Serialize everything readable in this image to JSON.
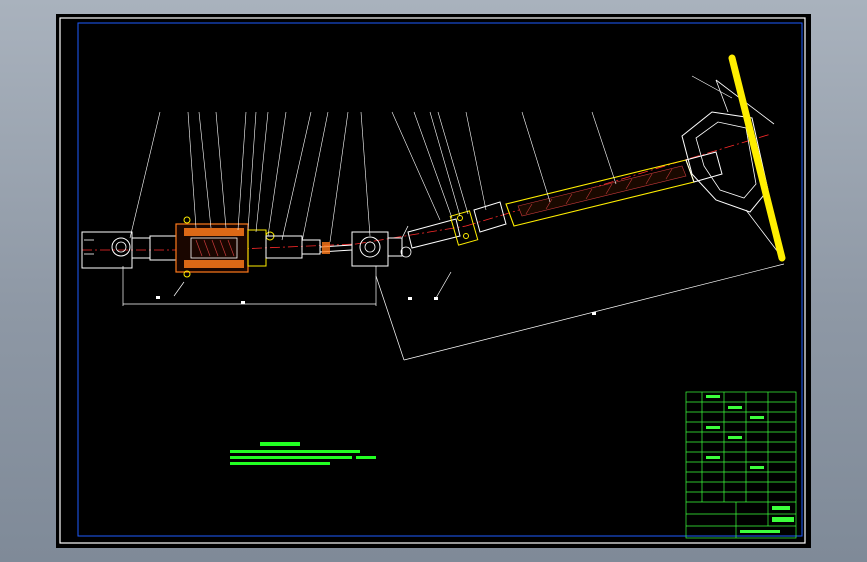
{
  "drawing": {
    "colors": {
      "background": "#000000",
      "frame": "#ffffff",
      "outline": "#ffffff",
      "centerline": "#ff2a2a",
      "section_fill": "#ff7a1a",
      "hatch": "#c83a3a",
      "yellow": "#ffee00",
      "blue": "#1e5bff",
      "green": "#22ff22",
      "title_block": "#3cff3c",
      "leader": "#ffffff"
    },
    "icons": {
      "steering_wheel": "steering-wheel-rim",
      "universal_joint": "cardan-cross-joint"
    }
  }
}
